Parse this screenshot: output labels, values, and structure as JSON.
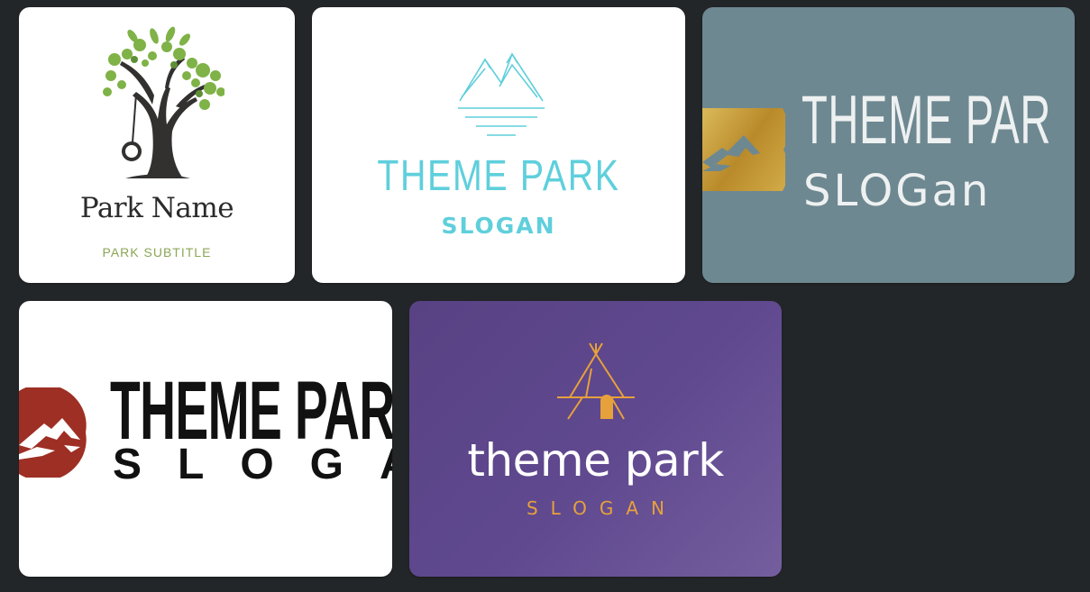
{
  "cards": [
    {
      "name": "Park Name",
      "subtitle": "PARK SUBTITLE",
      "colors": {
        "text": "#2b2b2b",
        "subtitle": "#8ba655",
        "leaves": "#7fb247"
      }
    },
    {
      "title": "THEME PARK",
      "slogan": "SLOGAN",
      "colors": {
        "text": "#5fcfdc",
        "background": "#ffffff"
      }
    },
    {
      "title": "THEME PAR",
      "slogan": "SLOGan",
      "colors": {
        "text": "#eef1f1",
        "background": "#6e8891",
        "sun": "#c9a33f"
      }
    },
    {
      "title": "THEME PAR",
      "slogan": "SLOGAN",
      "colors": {
        "text": "#111111",
        "sun": "#9e2f24"
      }
    },
    {
      "title": "theme park",
      "slogan": "SLOGAN",
      "colors": {
        "text": "#ffffff",
        "slogan": "#e7a13b",
        "background": "#5f4690"
      }
    }
  ],
  "icons": [
    "tree-icon",
    "mountain-lake-icon",
    "mountain-sun-icon",
    "mountain-sun-icon",
    "tepee-icon"
  ]
}
